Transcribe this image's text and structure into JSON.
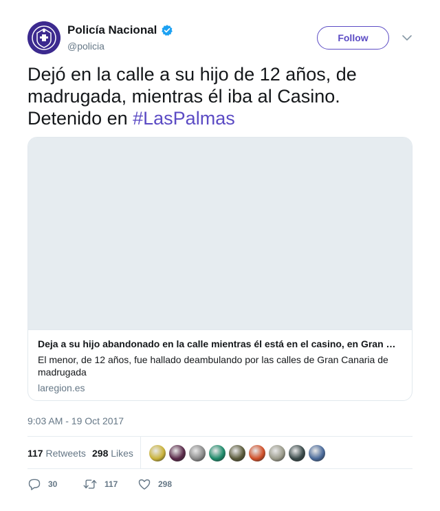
{
  "account": {
    "name": "Policía Nacional",
    "handle": "@policia",
    "verified": true,
    "follow_label": "Follow"
  },
  "tweet": {
    "text_before": "Dejó en la calle a su hijo de 12 años, de madrugada, mientras él iba al Casino. Detenido en ",
    "hashtag": "#LasPalmas",
    "timestamp": "9:03 AM - 19 Oct 2017"
  },
  "card": {
    "title": "Deja a su hijo abandonado en la calle mientras él está en el casino, en Gran …",
    "description": "El menor, de 12 años, fue hallado deambulando por las calles de Gran Canaria de madrugada",
    "domain": "laregion.es"
  },
  "stats": {
    "retweets_count": "117",
    "retweets_label": "Retweets",
    "likes_count": "298",
    "likes_label": "Likes"
  },
  "likers": [
    {
      "color": "#c9b23a"
    },
    {
      "color": "#5a2a4a"
    },
    {
      "color": "#8a8a8a"
    },
    {
      "color": "#1e8a6a"
    },
    {
      "color": "#5a5a3a"
    },
    {
      "color": "#d0502a"
    },
    {
      "color": "#9a9a8a"
    },
    {
      "color": "#3a4a4a"
    },
    {
      "color": "#4a6a9a"
    }
  ],
  "actions": {
    "reply_count": "30",
    "retweet_count": "117",
    "like_count": "298"
  },
  "colors": {
    "brand": "#5b4bc4",
    "text": "#14171a",
    "muted": "#657786",
    "verified": "#1da1f2"
  }
}
